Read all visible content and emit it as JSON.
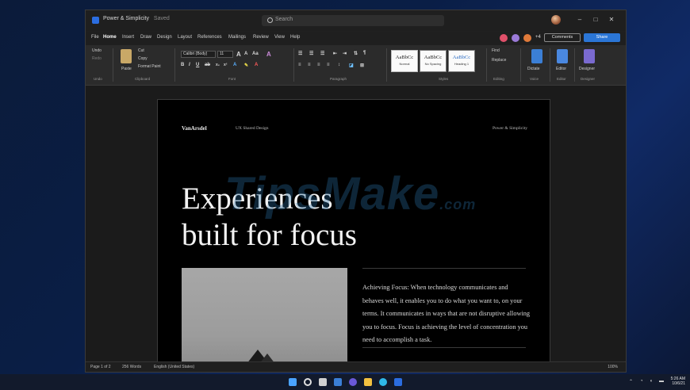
{
  "titlebar": {
    "doc_name": "Power & Simplicity",
    "saved": "Saved",
    "search_placeholder": "Search",
    "minimize": "–",
    "maximize": "□",
    "close": "✕"
  },
  "tabs": [
    "File",
    "Home",
    "Insert",
    "Draw",
    "Design",
    "Layout",
    "References",
    "Mailings",
    "Review",
    "View",
    "Help"
  ],
  "active_tab": "Home",
  "collab": {
    "extra_count": "+4",
    "comments_label": "Comments",
    "share_label": "Share"
  },
  "ribbon": {
    "undo": "Undo",
    "redo": "Redo",
    "paste": "Paste",
    "cut": "Cut",
    "copy": "Copy",
    "format_painter": "Format Paint",
    "font_name": "Calibri (Body)",
    "font_size": "11",
    "find": "Find",
    "replace": "Replace",
    "dictate": "Dictate",
    "editor": "Editor",
    "designer": "Designer",
    "styles": [
      {
        "sample": "AaBbCc",
        "name": "Normal"
      },
      {
        "sample": "AaBbCc",
        "name": "No Spacing"
      },
      {
        "sample": "AaBbCc",
        "name": "Heading 1"
      }
    ],
    "groups": {
      "undo": "Undo",
      "clipboard": "Clipboard",
      "font": "Font",
      "paragraph": "Paragraph",
      "styles": "Styles",
      "editing": "Editing",
      "voice": "Voice",
      "editor": "Editor",
      "designer": "Designer"
    }
  },
  "document": {
    "brand": "VanArsdel",
    "header_middle": "UX Shared Design",
    "header_right": "Power & Simplicity",
    "headline_line1": "Experiences",
    "headline_line2": "built for focus",
    "body": "Achieving Focus: When technology communicates and behaves well, it enables you to do what you want to, on your terms. It communicates in ways that are not disruptive allowing you to focus. Focus is achieving the level of concentration you need to accomplish a task.",
    "watermark": "TipsMake",
    "watermark_suffix": ".com"
  },
  "status": {
    "page": "Page 1 of 2",
    "words": "256 Words",
    "language": "English (United States)",
    "zoom": "100%"
  },
  "taskbar": {
    "time": "5:26 AM",
    "date": "10/6/21"
  },
  "colors": {
    "accent": "#2b76d6",
    "window_bg": "#202020",
    "page_bg": "#000000",
    "wallpaper": "#0a1e46"
  }
}
